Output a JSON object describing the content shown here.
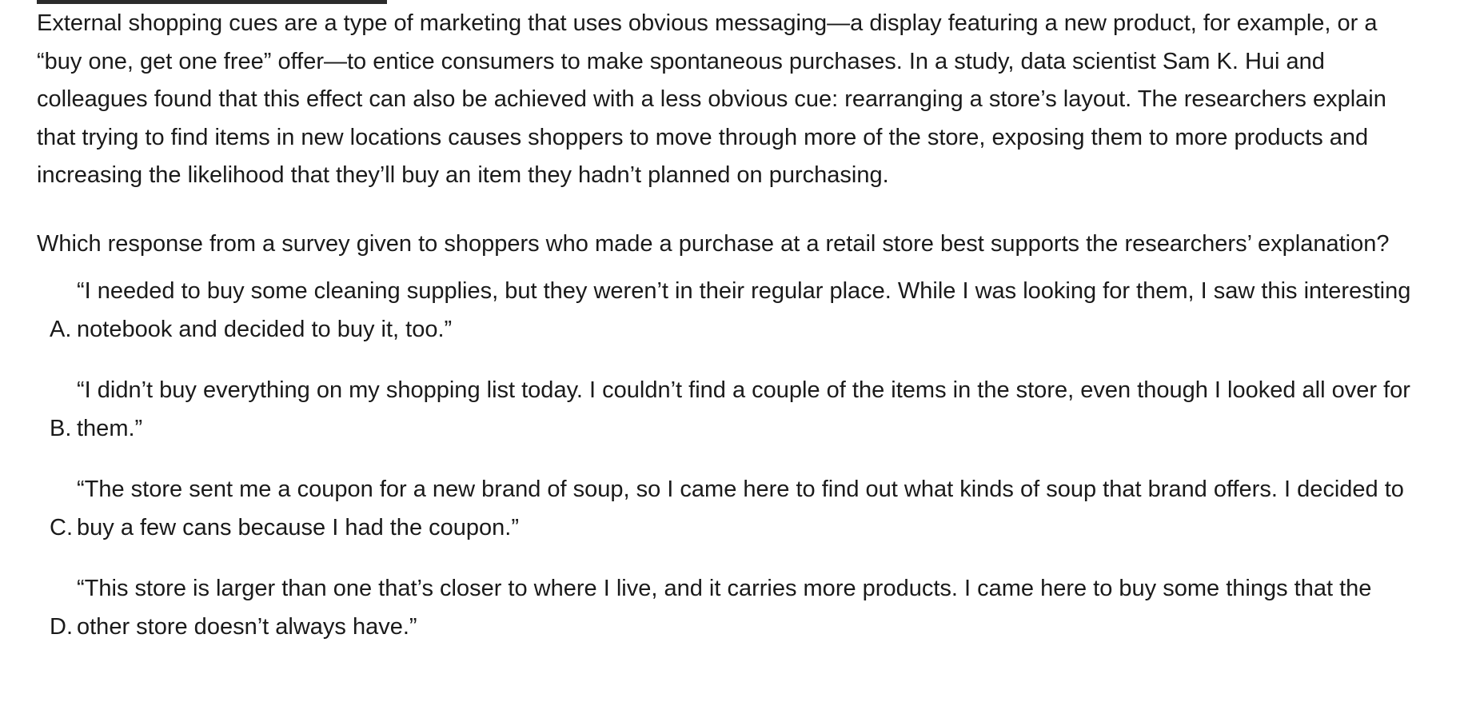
{
  "passage": "External shopping cues are a type of marketing that uses obvious messaging—a display featuring a new product, for example, or a “buy one, get one free” offer—to entice consumers to make spontaneous purchases. In a study, data scientist Sam K. Hui and colleagues found that this effect can also be achieved with a less obvious cue: rearranging a store’s layout. The researchers explain that trying to find items in new locations causes shoppers to move through more of the store, exposing them to more products and increasing the likelihood that they’ll buy an item they hadn’t planned on purchasing.",
  "question": "Which response from a survey given to shoppers who made a purchase at a retail store best supports the researchers’ explanation?",
  "choices": [
    {
      "letter": "A.",
      "text": "“I needed to buy some cleaning supplies, but they weren’t in their regular place. While I was looking for them, I saw this interesting notebook and decided to buy it, too.”"
    },
    {
      "letter": "B.",
      "text": "“I didn’t buy everything on my shopping list today. I couldn’t find a couple of the items in the store, even though I looked all over for them.”"
    },
    {
      "letter": "C.",
      "text": "“The store sent me a coupon for a new brand of soup, so I came here to find out what kinds of soup that brand offers. I decided to buy a few cans because I had the coupon.”"
    },
    {
      "letter": "D.",
      "text": "“This store is larger than one that’s closer to where I live, and it carries more products. I came here to buy some things that the other store doesn’t always have.”"
    }
  ]
}
